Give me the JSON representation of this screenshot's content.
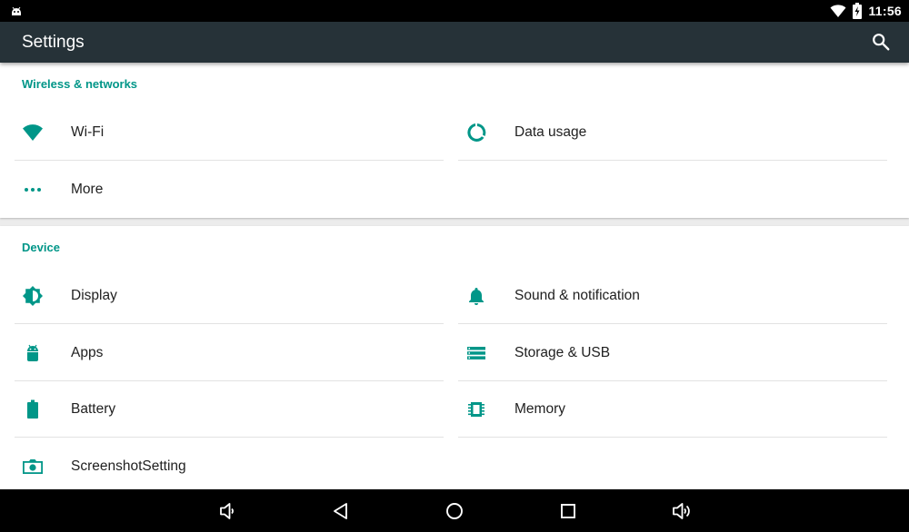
{
  "status_bar": {
    "time": "11:56",
    "icons": [
      "android-notification-icon",
      "wifi-icon",
      "battery-charging-icon"
    ]
  },
  "app_bar": {
    "title": "Settings",
    "icons": [
      "search-icon"
    ]
  },
  "sections": [
    {
      "header": "Wireless & networks",
      "items": [
        {
          "label": "Wi-Fi",
          "icon": "wifi-icon"
        },
        {
          "label": "Data usage",
          "icon": "data-usage-icon"
        },
        {
          "label": "More",
          "icon": "more-dots-icon"
        }
      ]
    },
    {
      "header": "Device",
      "items": [
        {
          "label": "Display",
          "icon": "brightness-icon"
        },
        {
          "label": "Sound & notification",
          "icon": "bell-icon"
        },
        {
          "label": "Apps",
          "icon": "android-icon"
        },
        {
          "label": "Storage & USB",
          "icon": "storage-icon"
        },
        {
          "label": "Battery",
          "icon": "battery-icon"
        },
        {
          "label": "Memory",
          "icon": "memory-chip-icon"
        },
        {
          "label": "ScreenshotSetting",
          "icon": "camera-icon"
        }
      ]
    }
  ],
  "nav_bar": {
    "icons": [
      "volume-down-icon",
      "back-icon",
      "home-icon",
      "recents-icon",
      "volume-up-icon"
    ]
  },
  "colors": {
    "accent": "#009688",
    "app_bar": "#263238",
    "status_bar": "#000000",
    "nav_bar": "#000000",
    "background": "#ececec",
    "card": "#ffffff",
    "text_primary": "#212121"
  }
}
